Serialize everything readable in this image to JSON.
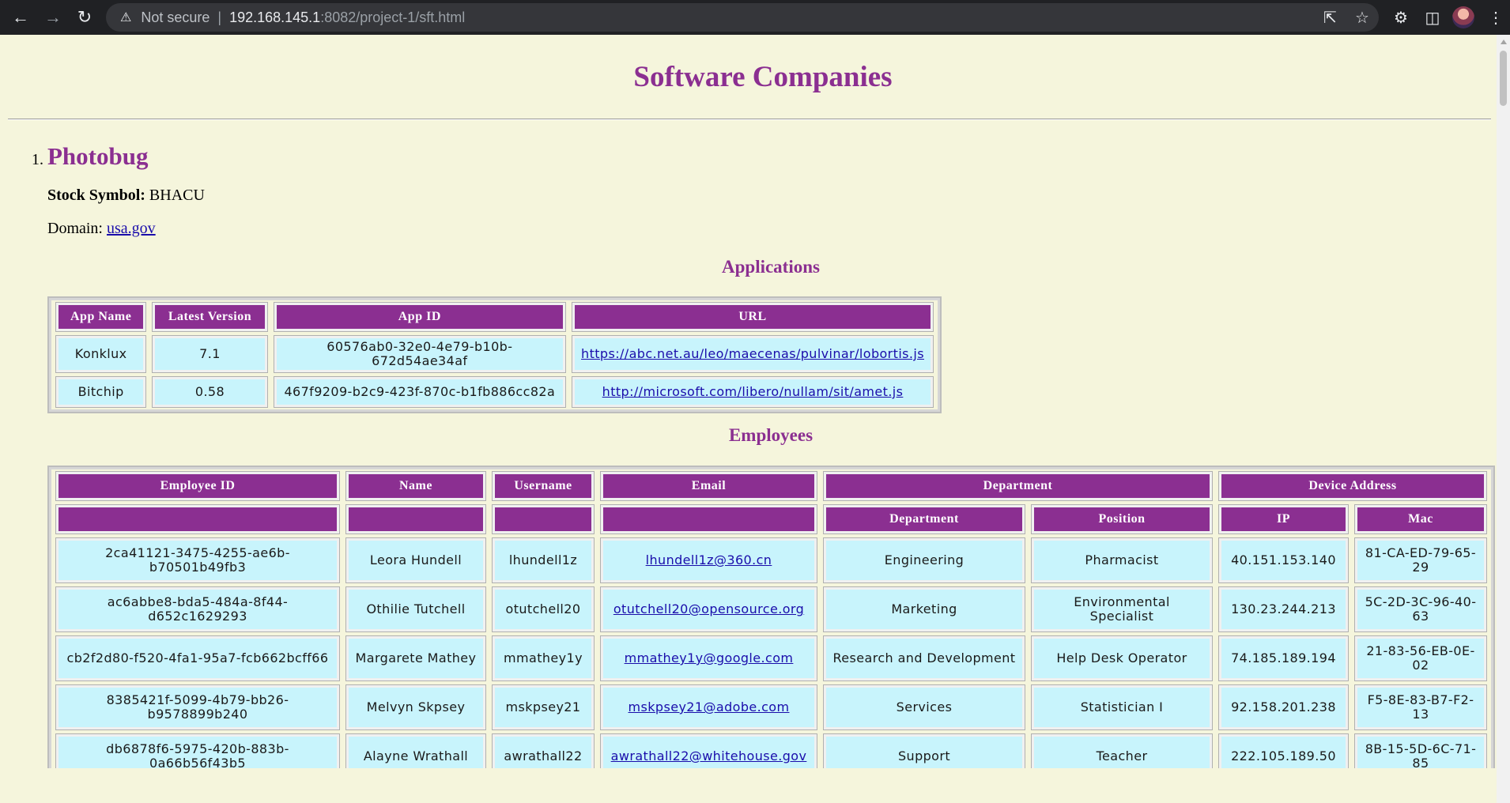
{
  "browser": {
    "not_secure": "Not secure",
    "url_host": "192.168.145.1",
    "url_path": ":8082/project-1/sft.html"
  },
  "page": {
    "title": "Software Companies"
  },
  "company": {
    "number": "1.",
    "name": "Photobug",
    "stock_label": "Stock Symbol:",
    "stock_value": "BHACU",
    "domain_label": "Domain:",
    "domain_value": "usa.gov"
  },
  "applications": {
    "heading": "Applications",
    "headers": [
      "App Name",
      "Latest Version",
      "App ID",
      "URL"
    ],
    "rows": [
      {
        "name": "Konklux",
        "version": "7.1",
        "id": "60576ab0-32e0-4e79-b10b-672d54ae34af",
        "url": "https://abc.net.au/leo/maecenas/pulvinar/lobortis.js"
      },
      {
        "name": "Bitchip",
        "version": "0.58",
        "id": "467f9209-b2c9-423f-870c-b1fb886cc82a",
        "url": "http://microsoft.com/libero/nullam/sit/amet.js"
      }
    ]
  },
  "employees": {
    "heading": "Employees",
    "headers": {
      "id": "Employee ID",
      "name": "Name",
      "username": "Username",
      "email": "Email",
      "department_group": "Department",
      "device_group": "Device Address",
      "department": "Department",
      "position": "Position",
      "ip": "IP",
      "mac": "Mac"
    },
    "rows": [
      {
        "id": "2ca41121-3475-4255-ae6b-b70501b49fb3",
        "name": "Leora Hundell",
        "username": "lhundell1z",
        "email": "lhundell1z@360.cn",
        "department": "Engineering",
        "position": "Pharmacist",
        "ip": "40.151.153.140",
        "mac": "81-CA-ED-79-65-29"
      },
      {
        "id": "ac6abbe8-bda5-484a-8f44-d652c1629293",
        "name": "Othilie Tutchell",
        "username": "otutchell20",
        "email": "otutchell20@opensource.org",
        "department": "Marketing",
        "position": "Environmental Specialist",
        "ip": "130.23.244.213",
        "mac": "5C-2D-3C-96-40-63"
      },
      {
        "id": "cb2f2d80-f520-4fa1-95a7-fcb662bcff66",
        "name": "Margarete Mathey",
        "username": "mmathey1y",
        "email": "mmathey1y@google.com",
        "department": "Research and Development",
        "position": "Help Desk Operator",
        "ip": "74.185.189.194",
        "mac": "21-83-56-EB-0E-02"
      },
      {
        "id": "8385421f-5099-4b79-bb26-b9578899b240",
        "name": "Melvyn Skpsey",
        "username": "mskpsey21",
        "email": "mskpsey21@adobe.com",
        "department": "Services",
        "position": "Statistician I",
        "ip": "92.158.201.238",
        "mac": "F5-8E-83-B7-F2-13"
      },
      {
        "id": "db6878f6-5975-420b-883b-0a66b56f43b5",
        "name": "Alayne Wrathall",
        "username": "awrathall22",
        "email": "awrathall22@whitehouse.gov",
        "department": "Support",
        "position": "Teacher",
        "ip": "222.105.189.50",
        "mac": "8B-15-5D-6C-71-85"
      }
    ]
  }
}
